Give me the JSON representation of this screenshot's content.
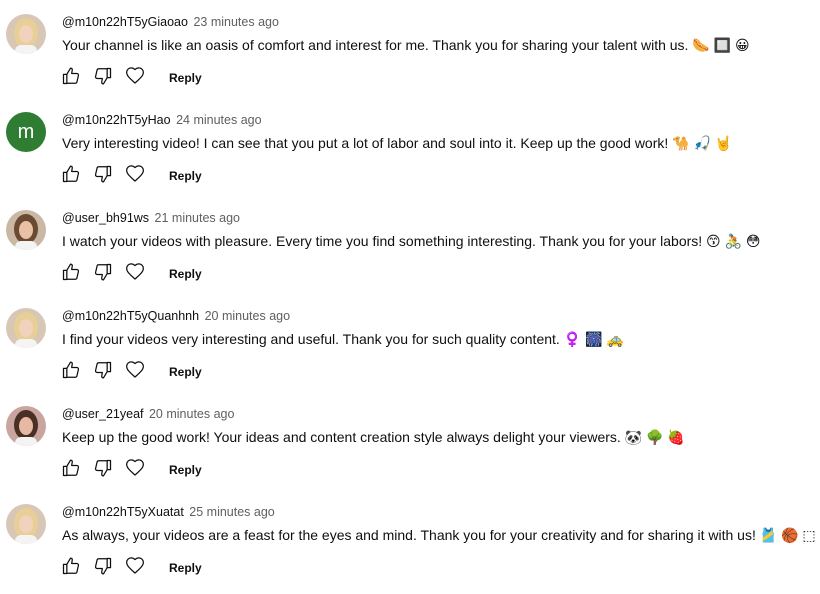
{
  "comments": [
    {
      "author": "@m10n22hT5yGiaoao",
      "time": "23 minutes ago",
      "text": "Your channel is like an oasis of comfort and interest for me. Thank you for sharing your talent with us. 🌭 🔲 😀",
      "avatar": {
        "kind": "photo",
        "bg": "#d9c7b6",
        "hair": "#e7cf95",
        "skin": "#f1d2bd"
      },
      "reply_label": "Reply"
    },
    {
      "author": "@m10n22hT5yHao",
      "time": "24 minutes ago",
      "text": "Very interesting video! I can see that you put a lot of labor and soul into it. Keep up the good work! 🐪 🎣 🤘",
      "avatar": {
        "kind": "letter",
        "letter": "m",
        "bg": "#2e7d32"
      },
      "reply_label": "Reply"
    },
    {
      "author": "@user_bh91ws",
      "time": "21 minutes ago",
      "text": "I watch your videos with pleasure. Every time you find something interesting. Thank you for your labors! 😙 🚴 😳",
      "avatar": {
        "kind": "photo",
        "bg": "#cbb8a4",
        "hair": "#6b4a33",
        "skin": "#e8c1a6"
      },
      "reply_label": "Reply"
    },
    {
      "author": "@m10n22hT5yQuanhnh",
      "time": "20 minutes ago",
      "text": "I find your videos very interesting and useful. Thank you for such quality content. ♀️ 🎆 🚕",
      "avatar": {
        "kind": "photo",
        "bg": "#d9c7b6",
        "hair": "#e7cf95",
        "skin": "#f1d2bd"
      },
      "reply_label": "Reply"
    },
    {
      "author": "@user_21yeaf",
      "time": "20 minutes ago",
      "text": "Keep up the good work! Your ideas and content creation style always delight your viewers. 🐼 🌳 🍓",
      "avatar": {
        "kind": "photo",
        "bg": "#c9a5a0",
        "hair": "#4a2f24",
        "skin": "#e6b9a3"
      },
      "reply_label": "Reply"
    },
    {
      "author": "@m10n22hT5yXuatat",
      "time": "25 minutes ago",
      "text": "As always, your videos are a feast for the eyes and mind. Thank you for your creativity and for sharing it with us! 🎽 🏀 ⬚",
      "avatar": {
        "kind": "photo",
        "bg": "#d9c7b6",
        "hair": "#e7cf95",
        "skin": "#f1d2bd"
      },
      "reply_label": "Reply"
    }
  ],
  "icons": {
    "like": "thumb-up-icon",
    "dislike": "thumb-down-icon",
    "heart": "heart-icon"
  },
  "colors": {
    "text": "#0f0f0f",
    "meta": "#606060",
    "icon": "#0f0f0f"
  }
}
